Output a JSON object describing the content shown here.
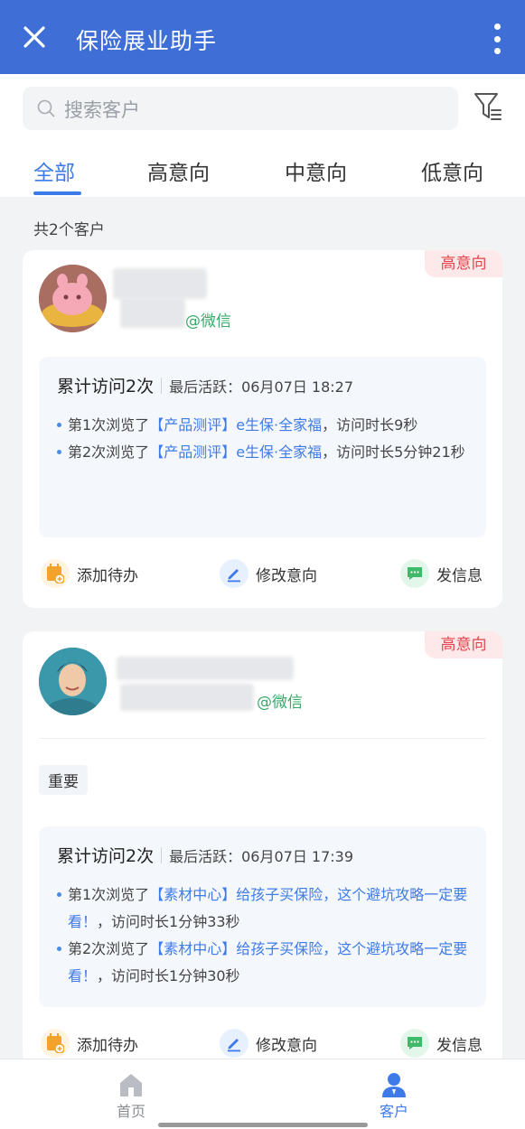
{
  "app": {
    "title": "保险展业助手"
  },
  "search": {
    "placeholder": "搜索客户"
  },
  "tabs": [
    {
      "label": "全部",
      "active": true
    },
    {
      "label": "高意向",
      "active": false
    },
    {
      "label": "中意向",
      "active": false
    },
    {
      "label": "低意向",
      "active": false
    }
  ],
  "summary": {
    "count_text": "共2个客户"
  },
  "customers": [
    {
      "intent_badge": "高意向",
      "source": "@微信",
      "tag": "",
      "visit_total": "累计访问2次",
      "last_active_label": "最后活跃：",
      "last_active_time": "06月07日 18:27",
      "visits": [
        {
          "prefix": "第1次浏览了",
          "link": "【产品测评】e生保·全家福",
          "suffix": "，访问时长9秒"
        },
        {
          "prefix": "第2次浏览了",
          "link": "【产品测评】e生保·全家福",
          "suffix": "，访问时长5分钟21秒"
        }
      ],
      "actions": {
        "todo": "添加待办",
        "edit_intent": "修改意向",
        "message": "发信息"
      }
    },
    {
      "intent_badge": "高意向",
      "source": "@微信",
      "tag": "重要",
      "visit_total": "累计访问2次",
      "last_active_label": "最后活跃：",
      "last_active_time": "06月07日 17:39",
      "visits": [
        {
          "prefix": "第1次浏览了",
          "link": "【素材中心】给孩子买保险，这个避坑攻略一定要看！",
          "suffix": "，访问时长1分钟33秒"
        },
        {
          "prefix": "第2次浏览了",
          "link": "【素材中心】给孩子买保险，这个避坑攻略一定要看！",
          "suffix": "，访问时长1分钟30秒"
        }
      ],
      "actions": {
        "todo": "添加待办",
        "edit_intent": "修改意向",
        "message": "发信息"
      }
    }
  ],
  "bottom_nav": [
    {
      "label": "首页",
      "active": false
    },
    {
      "label": "客户",
      "active": true
    }
  ],
  "colors": {
    "primary": "#3f6fd6",
    "accent": "#3f7be8",
    "badge": "#e2454e",
    "wechat": "#3aa86a"
  }
}
